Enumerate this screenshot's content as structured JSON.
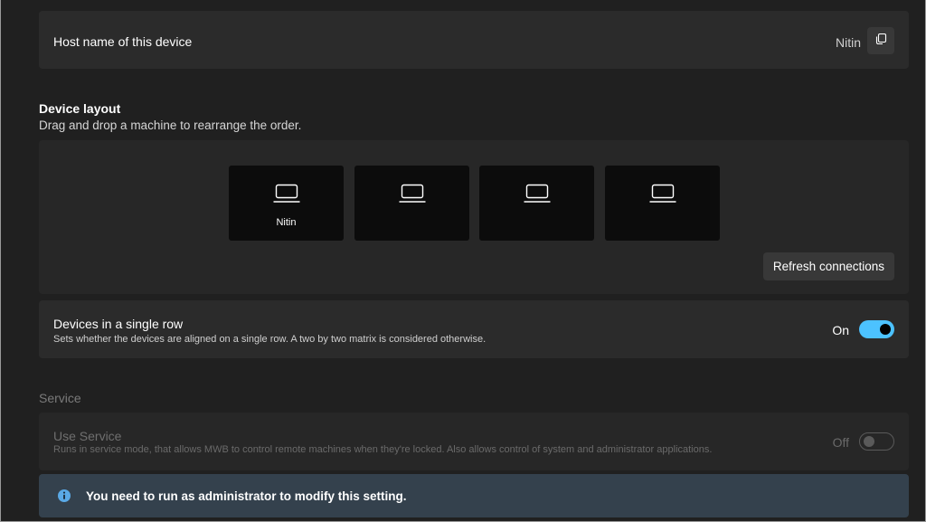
{
  "host": {
    "label": "Host name of this device",
    "value": "Nitin",
    "copy_icon": "copy-icon"
  },
  "device_layout": {
    "title": "Device layout",
    "subtitle": "Drag and drop a machine to rearrange the order.",
    "machines": [
      {
        "name": "Nitin",
        "icon": "laptop-icon"
      },
      {
        "name": "",
        "icon": "laptop-icon"
      },
      {
        "name": "",
        "icon": "laptop-icon"
      },
      {
        "name": "",
        "icon": "laptop-icon"
      }
    ],
    "refresh_label": "Refresh connections"
  },
  "single_row": {
    "title": "Devices in a single row",
    "description": "Sets whether the devices are aligned on a single row. A two by two matrix is considered otherwise.",
    "state_label": "On",
    "enabled": true
  },
  "service": {
    "section_title": "Service",
    "title": "Use Service",
    "description": "Runs in service mode, that allows MWB to control remote machines when they're locked. Also allows control of system and administrator applications.",
    "state_label": "Off",
    "enabled": false
  },
  "info": {
    "icon": "info-icon",
    "message": "You need to run as administrator to modify this setting."
  },
  "colors": {
    "background": "#202020",
    "card": "#2b2b2b",
    "accent": "#4cc2ff",
    "info_bar": "#34414d"
  }
}
